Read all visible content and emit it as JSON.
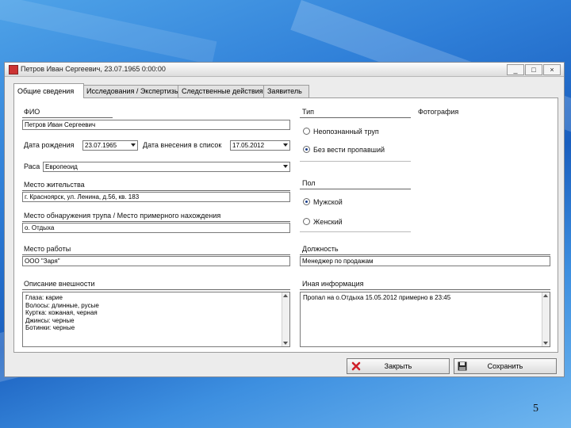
{
  "window": {
    "title": "Петров Иван Сергеевич, 23.07.1965 0:00:00",
    "minimize": "_",
    "maximize": "□",
    "close": "×"
  },
  "tabs": [
    {
      "label": "Общие сведения",
      "active": true
    },
    {
      "label": "Исследования / Экспертизы",
      "active": false
    },
    {
      "label": "Следственные действия",
      "active": false
    },
    {
      "label": "Заявитель",
      "active": false
    }
  ],
  "form": {
    "fio_label": "ФИО",
    "fio_value": "Петров Иван Сергеевич",
    "dob_label": "Дата рождения",
    "dob_value": "23.07.1965",
    "search_date_label": "Дата внесения в список",
    "search_date_value": "17.05.2012",
    "race_label": "Раса",
    "race_value": "Европеоид",
    "residence_label": "Место жительства",
    "residence_value": "г. Красноярск, ул. Ленина, д.56, кв. 183",
    "found_label": "Место обнаружения трупа / Место примерного нахождения",
    "found_value": "о. Отдыха",
    "work_label": "Место работы",
    "work_value": "ООО \"Заря\"",
    "appearance_label": "Описание внешности",
    "appearance_lines": [
      "Глаза: карие",
      "Волосы: длинные, русые",
      "Куртка: кожаная, черная",
      "Джинсы: черные",
      "Ботинки: черные"
    ],
    "type_label": "Тип",
    "type_options": [
      {
        "label": "Неопознанный труп",
        "checked": false
      },
      {
        "label": "Без вести пропавший",
        "checked": true
      }
    ],
    "photo_label": "Фотография",
    "gender_label": "Пол",
    "gender_options": [
      {
        "label": "Мужской",
        "checked": true
      },
      {
        "label": "Женский",
        "checked": false
      }
    ],
    "position_label": "Должность",
    "position_value": "Менеджер по продажам",
    "other_label": "Иная информация",
    "other_value": "Пропал на о.Отдыха 15.05.2012 примерно в 23:45"
  },
  "buttons": {
    "close": "Закрыть",
    "save": "Сохранить"
  },
  "slide_number": "5",
  "colors": {
    "desktop": "#2f7fd8",
    "window_bg": "#ececec",
    "close_icon": "#d0202a",
    "radio_dot": "#1a3e8c"
  }
}
